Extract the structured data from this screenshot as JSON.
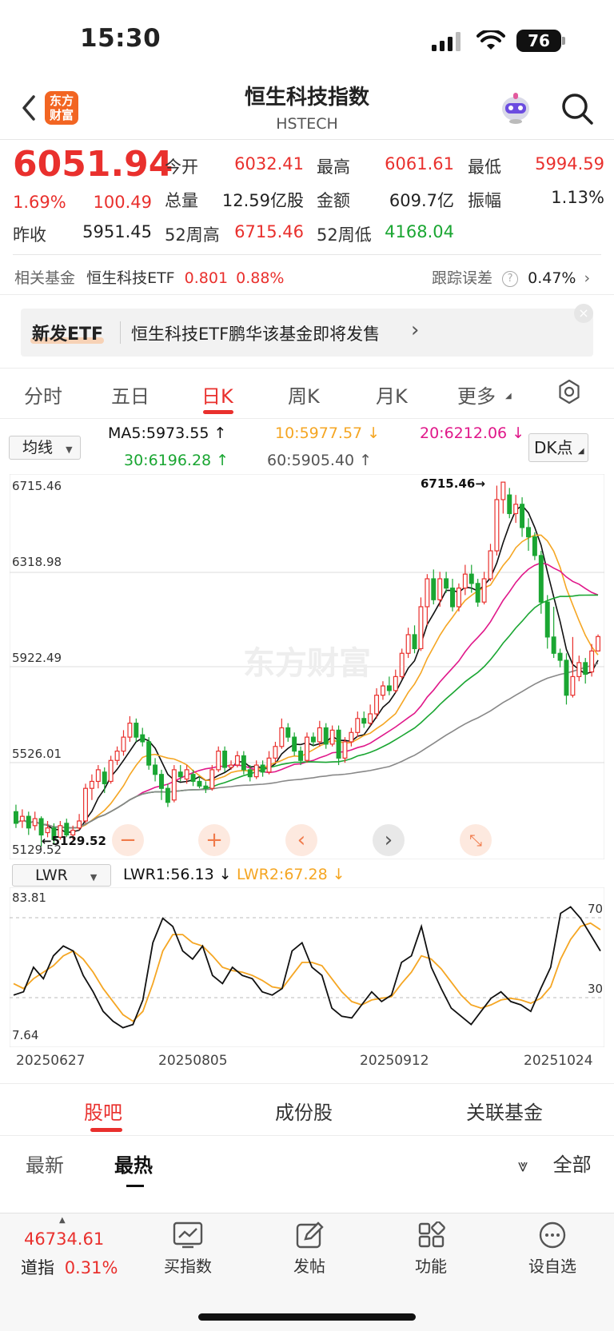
{
  "status_bar": {
    "time": "15:30",
    "battery": "76"
  },
  "header": {
    "app_logo": "东方财富",
    "title": "恒生科技指数",
    "subtitle": "HSTECH"
  },
  "quote": {
    "price": "6051.94",
    "change_pct": "1.69%",
    "change": "100.49",
    "open_label": "今开",
    "open": "6032.41",
    "high_label": "最高",
    "high": "6061.61",
    "low_label": "最低",
    "low": "5994.59",
    "volume_label": "总量",
    "volume": "12.59亿股",
    "amount_label": "金额",
    "amount": "609.7亿",
    "amplitude_label": "振幅",
    "amplitude": "1.13%",
    "prev_close_label": "昨收",
    "prev_close": "5951.45",
    "wk52_high_label": "52周高",
    "wk52_high": "6715.46",
    "wk52_low_label": "52周低",
    "wk52_low": "4168.04"
  },
  "related_fund": {
    "label": "相关基金",
    "name": "恒生科技ETF",
    "price": "0.801",
    "pct": "0.88%",
    "tracking_label": "跟踪误差",
    "tracking": "0.47%"
  },
  "banner": {
    "tag": "新发ETF",
    "text": "恒生科技ETF鹏华该基金即将发售"
  },
  "chart_tabs": [
    "分时",
    "五日",
    "日K",
    "周K",
    "月K",
    "更多"
  ],
  "ma": {
    "select": "均线",
    "ma5": "MA5:5973.55",
    "ma10": "10:5977.57",
    "ma20": "20:6212.06",
    "ma30": "30:6196.28",
    "ma60": "60:5905.40",
    "dk": "DK点"
  },
  "colors": {
    "up": "#e9302d",
    "down": "#1aa632",
    "ma5": "#111111",
    "ma10": "#f5a623",
    "ma20": "#e0188a",
    "ma30": "#1aa632",
    "ma60": "#888888"
  },
  "chart_data": [
    {
      "type": "candlestick",
      "y_ticks": [
        "6715.46",
        "6318.98",
        "5922.49",
        "5526.01",
        "5129.52"
      ],
      "ylim": [
        5129.52,
        6715.46
      ],
      "max_marker": "6715.46",
      "min_marker": "5129.52",
      "watermark": "东方财富",
      "candles": [
        [
          5300,
          5250,
          5330,
          5230
        ],
        [
          5260,
          5280,
          5310,
          5230
        ],
        [
          5280,
          5230,
          5300,
          5200
        ],
        [
          5240,
          5270,
          5300,
          5220
        ],
        [
          5270,
          5200,
          5280,
          5150
        ],
        [
          5210,
          5230,
          5260,
          5190
        ],
        [
          5230,
          5180,
          5250,
          5160
        ],
        [
          5190,
          5240,
          5260,
          5180
        ],
        [
          5250,
          5200,
          5270,
          5190
        ],
        [
          5200,
          5220,
          5240,
          5180
        ],
        [
          5230,
          5260,
          5290,
          5220
        ],
        [
          5260,
          5400,
          5420,
          5250
        ],
        [
          5400,
          5430,
          5460,
          5350
        ],
        [
          5430,
          5480,
          5500,
          5400
        ],
        [
          5470,
          5420,
          5490,
          5380
        ],
        [
          5430,
          5520,
          5540,
          5420
        ],
        [
          5520,
          5560,
          5580,
          5500
        ],
        [
          5560,
          5620,
          5650,
          5540
        ],
        [
          5620,
          5680,
          5710,
          5600
        ],
        [
          5680,
          5620,
          5700,
          5600
        ],
        [
          5630,
          5600,
          5660,
          5580
        ],
        [
          5600,
          5500,
          5620,
          5480
        ],
        [
          5500,
          5460,
          5530,
          5430
        ],
        [
          5460,
          5400,
          5480,
          5350
        ],
        [
          5400,
          5340,
          5420,
          5320
        ],
        [
          5350,
          5480,
          5500,
          5340
        ],
        [
          5470,
          5450,
          5500,
          5430
        ],
        [
          5440,
          5480,
          5500,
          5420
        ],
        [
          5460,
          5430,
          5480,
          5410
        ],
        [
          5430,
          5410,
          5450,
          5400
        ],
        [
          5410,
          5400,
          5430,
          5380
        ],
        [
          5400,
          5480,
          5500,
          5390
        ],
        [
          5480,
          5560,
          5580,
          5470
        ],
        [
          5560,
          5490,
          5580,
          5470
        ],
        [
          5490,
          5500,
          5520,
          5480
        ],
        [
          5500,
          5540,
          5560,
          5490
        ],
        [
          5540,
          5480,
          5560,
          5460
        ],
        [
          5480,
          5450,
          5500,
          5430
        ],
        [
          5450,
          5500,
          5520,
          5440
        ],
        [
          5500,
          5470,
          5520,
          5450
        ],
        [
          5470,
          5530,
          5560,
          5460
        ],
        [
          5530,
          5580,
          5600,
          5510
        ],
        [
          5580,
          5660,
          5700,
          5570
        ],
        [
          5660,
          5620,
          5680,
          5600
        ],
        [
          5620,
          5560,
          5640,
          5540
        ],
        [
          5560,
          5520,
          5580,
          5500
        ],
        [
          5520,
          5620,
          5640,
          5510
        ],
        [
          5620,
          5600,
          5640,
          5580
        ],
        [
          5600,
          5660,
          5690,
          5580
        ],
        [
          5660,
          5590,
          5680,
          5570
        ],
        [
          5590,
          5650,
          5670,
          5580
        ],
        [
          5650,
          5530,
          5670,
          5500
        ],
        [
          5530,
          5600,
          5620,
          5510
        ],
        [
          5600,
          5640,
          5660,
          5580
        ],
        [
          5640,
          5700,
          5730,
          5620
        ],
        [
          5700,
          5680,
          5730,
          5660
        ],
        [
          5680,
          5720,
          5760,
          5670
        ],
        [
          5720,
          5800,
          5830,
          5700
        ],
        [
          5800,
          5840,
          5860,
          5780
        ],
        [
          5840,
          5820,
          5880,
          5800
        ],
        [
          5820,
          5880,
          5910,
          5810
        ],
        [
          5880,
          5980,
          6000,
          5870
        ],
        [
          5980,
          6060,
          6090,
          5960
        ],
        [
          6060,
          6000,
          6100,
          5980
        ],
        [
          6000,
          6180,
          6220,
          5990
        ],
        [
          6180,
          6300,
          6320,
          6100
        ],
        [
          6300,
          6210,
          6340,
          6190
        ],
        [
          6210,
          6300,
          6330,
          6180
        ],
        [
          6300,
          6260,
          6330,
          6240
        ],
        [
          6260,
          6180,
          6300,
          6160
        ],
        [
          6180,
          6260,
          6280,
          6160
        ],
        [
          6260,
          6320,
          6360,
          6230
        ],
        [
          6320,
          6280,
          6360,
          6240
        ],
        [
          6280,
          6200,
          6300,
          6180
        ],
        [
          6200,
          6300,
          6330,
          6190
        ],
        [
          6300,
          6420,
          6450,
          6290
        ],
        [
          6420,
          6640,
          6700,
          6400
        ],
        [
          6640,
          6715,
          6715,
          6580
        ],
        [
          6660,
          6580,
          6690,
          6560
        ],
        [
          6580,
          6620,
          6660,
          6540
        ],
        [
          6620,
          6520,
          6650,
          6480
        ],
        [
          6520,
          6480,
          6560,
          6420
        ],
        [
          6480,
          6400,
          6500,
          6380
        ],
        [
          6400,
          6200,
          6420,
          6150
        ],
        [
          6200,
          6050,
          6230,
          6000
        ],
        [
          6050,
          5980,
          6180,
          5960
        ],
        [
          5980,
          5950,
          6000,
          5920
        ],
        [
          5950,
          5800,
          5980,
          5760
        ],
        [
          5800,
          5880,
          6050,
          5790
        ],
        [
          5880,
          5940,
          5970,
          5860
        ],
        [
          5940,
          5890,
          5960,
          5850
        ],
        [
          5900,
          5990,
          6020,
          5880
        ],
        [
          5990,
          6052,
          6061,
          5995
        ]
      ]
    },
    {
      "type": "line",
      "name": "LWR",
      "select": "LWR",
      "lwr1_label": "LWR1:56.13",
      "lwr2_label": "LWR2:67.28",
      "y_ticks": [
        "83.81",
        "7.64"
      ],
      "ref_levels": [
        "70",
        "30"
      ],
      "x_ticks": [
        "20250627",
        "20250805",
        "20250912",
        "20251024"
      ],
      "lwr1": [
        28,
        30,
        45,
        38,
        52,
        58,
        55,
        40,
        30,
        18,
        12,
        8,
        10,
        25,
        60,
        75,
        70,
        55,
        50,
        58,
        40,
        35,
        45,
        40,
        38,
        30,
        28,
        32,
        55,
        60,
        45,
        40,
        20,
        15,
        14,
        22,
        30,
        24,
        28,
        48,
        52,
        70,
        45,
        32,
        20,
        15,
        10,
        18,
        26,
        30,
        24,
        22,
        18,
        32,
        45,
        78,
        82,
        75,
        65,
        55
      ],
      "lwr2": [
        35,
        32,
        38,
        42,
        46,
        52,
        55,
        50,
        42,
        32,
        24,
        16,
        12,
        18,
        35,
        55,
        65,
        65,
        60,
        58,
        52,
        45,
        43,
        42,
        40,
        37,
        33,
        32,
        40,
        48,
        48,
        46,
        38,
        30,
        24,
        22,
        25,
        26,
        27,
        35,
        42,
        52,
        50,
        44,
        36,
        28,
        22,
        20,
        22,
        25,
        26,
        25,
        23,
        26,
        33,
        50,
        62,
        70,
        72,
        68
      ]
    }
  ],
  "bottom_tabs": [
    "股吧",
    "成份股",
    "关联基金"
  ],
  "sub_tabs": [
    "最新",
    "最热"
  ],
  "filter_label": "全部",
  "bottom_nav": {
    "index_value": "46734.61",
    "index_name": "道指",
    "index_pct": "0.31%",
    "items": [
      "买指数",
      "发帖",
      "功能",
      "设自选"
    ]
  }
}
